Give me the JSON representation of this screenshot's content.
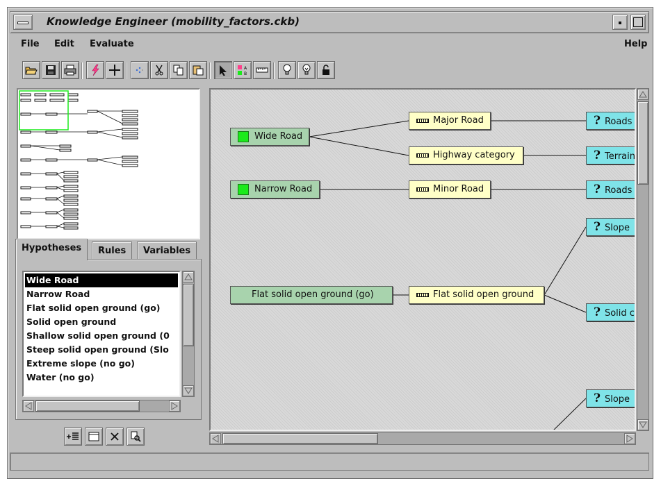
{
  "window": {
    "title": "Knowledge Engineer (mobility_factors.ckb)"
  },
  "menu": {
    "file": "File",
    "edit": "Edit",
    "evaluate": "Evaluate",
    "help": "Help"
  },
  "toolbar": {
    "buttons": [
      "open-icon",
      "save-icon",
      "print-icon",
      "lightning-icon",
      "crosshair-icon",
      "sparkle-icon",
      "cut-icon",
      "copy-icon",
      "paste-icon",
      "pointer-icon",
      "ab-icon",
      "ruler-icon",
      "bulb-off-icon",
      "bulb-on-icon",
      "lock-icon"
    ]
  },
  "tabs": {
    "hypotheses": "Hypotheses",
    "rules": "Rules",
    "variables": "Variables"
  },
  "hypotheses": [
    "Wide Road",
    "Narrow Road",
    "Flat solid open ground (go)",
    "Solid open ground",
    "Shallow solid open ground (0",
    "Steep solid open ground (Slo",
    "Extreme slope (no go)",
    "Water (no go)"
  ],
  "graph": {
    "hyp_wide_road": "Wide Road",
    "hyp_narrow_road": "Narrow Road",
    "hyp_flat_solid": "Flat solid open ground (go)",
    "rule_major_road": "Major Road",
    "rule_highway_category": "Highway category",
    "rule_minor_road": "Minor Road",
    "rule_flat_solid": "Flat solid open ground",
    "var_roads_1": "Roads",
    "var_terrain": "Terrain",
    "var_roads_2": "Roads",
    "var_slope_1": "Slope",
    "var_solid": "Solid c",
    "var_slope_2": "Slope"
  },
  "colors": {
    "hypothesis_node": "#a8d3ad",
    "rule_node": "#ffffc7",
    "variable_node": "#7fe3e8",
    "hypothesis_swatch": "#1bea1b"
  }
}
